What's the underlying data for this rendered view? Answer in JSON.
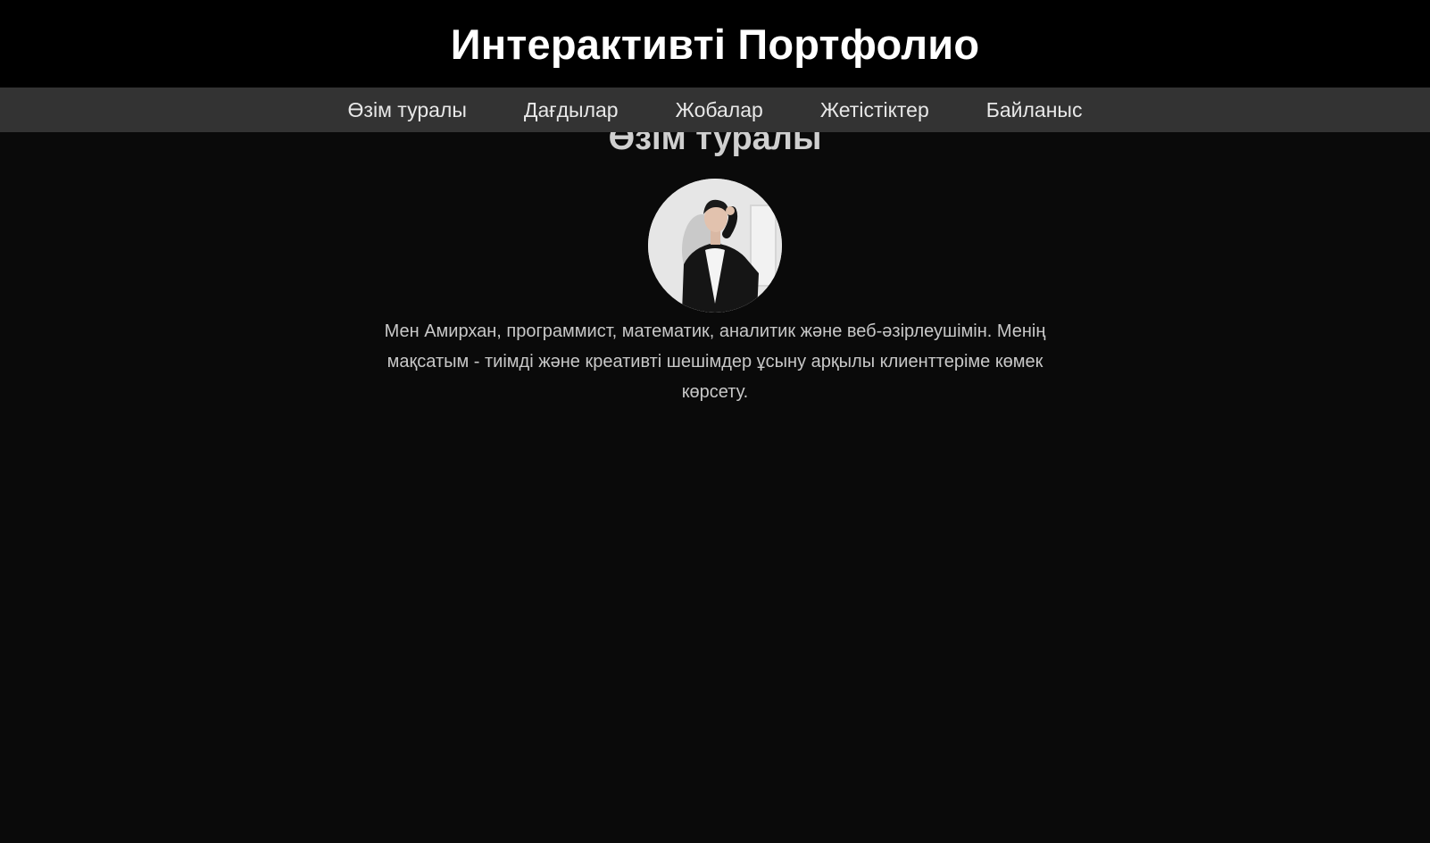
{
  "header": {
    "title": "Интерактивті Портфолио"
  },
  "nav": {
    "items": [
      {
        "label": "Өзім туралы"
      },
      {
        "label": "Дағдылар"
      },
      {
        "label": "Жобалар"
      },
      {
        "label": "Жетістіктер"
      },
      {
        "label": "Байланыс"
      }
    ]
  },
  "about": {
    "title": "Өзім туралы",
    "avatar_icon": "profile-photo",
    "description": "Мен Амирхан, программист, математик, аналитик және веб-әзірлеушімін. Менің мақсатым - тиімді және креативті шешімдер ұсыну арқылы клиенттеріме көмек көрсету."
  },
  "colors": {
    "header_bg": "#000000",
    "nav_bg": "#333333",
    "page_bg": "#0a0a0a",
    "text": "#c8c8c8"
  }
}
